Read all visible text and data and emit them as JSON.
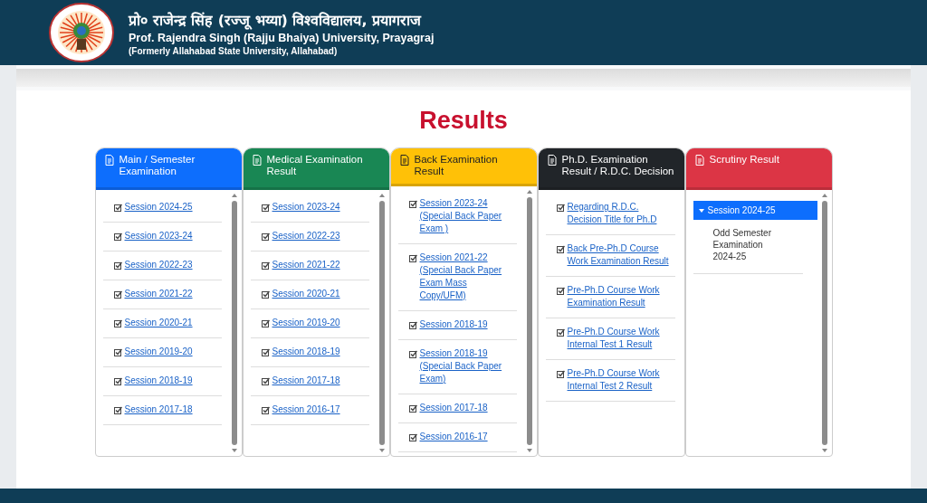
{
  "header": {
    "title_hindi": "प्रो० राजेन्द्र सिंह (रज्जू भय्या) विश्वविद्यालय, प्रयागराज",
    "title_english": "Prof. Rajendra Singh (Rajju Bhaiya) University, Prayagraj",
    "subtitle": "(Formerly Allahabad State University, Allahabad)"
  },
  "page_title": "Results",
  "cards": [
    {
      "kind": "links",
      "title": "Main / Semester Examination",
      "color": "#0d6efd",
      "scrollbar": true,
      "items": [
        "Session 2024-25",
        "Session 2023-24",
        "Session 2022-23",
        "Session 2021-22",
        "Session 2020-21",
        "Session 2019-20",
        "Session 2018-19",
        "Session 2017-18"
      ]
    },
    {
      "kind": "links",
      "title": "Medical Examination Result",
      "color": "#198754",
      "scrollbar": true,
      "items": [
        "Session 2023-24",
        "Session 2022-23",
        "Session 2021-22",
        "Session 2020-21",
        "Session 2019-20",
        "Session 2018-19",
        "Session 2017-18",
        "Session 2016-17"
      ]
    },
    {
      "kind": "links",
      "title": "Back Examination Result",
      "color": "#ffc107",
      "scrollbar": true,
      "items": [
        "Session 2023-24 (Special Back Paper Exam )",
        "Session 2021-22 (Special Back Paper Exam Mass Copy/UFM)",
        "Session 2018-19",
        "Session 2018-19 (Special Back Paper Exam)",
        "Session 2017-18",
        "Session 2016-17"
      ]
    },
    {
      "kind": "links",
      "title": "Ph.D. Examination Result / R.D.C. Decision",
      "color": "#212529",
      "scrollbar": false,
      "items": [
        "Regarding R.D.C. Decision Title for Ph.D",
        "Back Pre-Ph.D Course Work Examination Result",
        "Pre-Ph.D Course Work Examination Result",
        " Pre-Ph.D Course Work Internal Test 1 Result",
        " Pre-Ph.D Course Work Internal Test 2 Result"
      ]
    },
    {
      "kind": "accordion",
      "title": "Scrutiny Result",
      "color": "#dc3545",
      "scrollbar": true,
      "sections": [
        {
          "label": "Session 2024-25",
          "expanded": true,
          "items": [
            "Odd Semester Examination 2024-25"
          ]
        }
      ]
    }
  ]
}
